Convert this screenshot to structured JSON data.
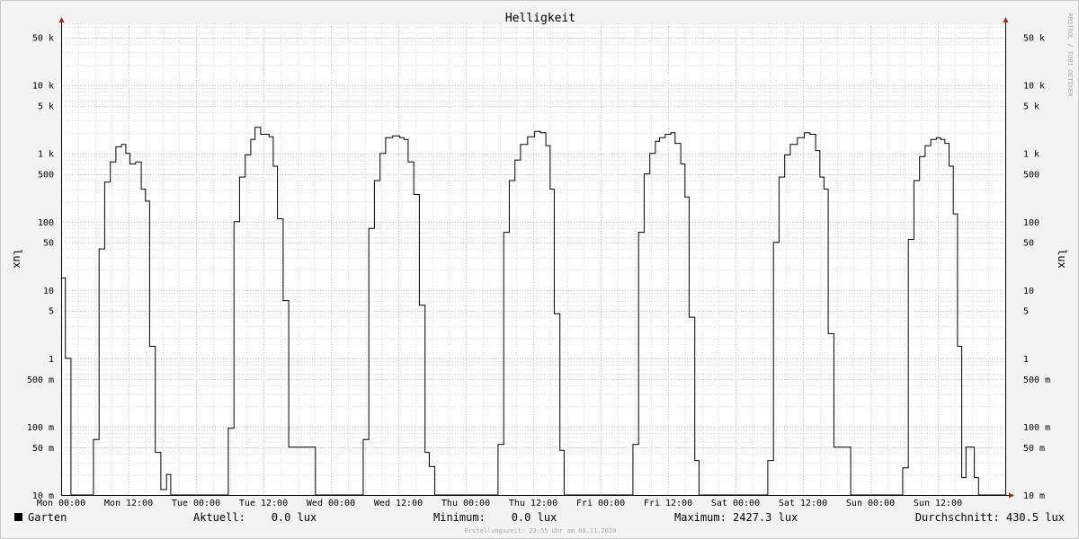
{
  "chart_data": {
    "type": "line",
    "title": "Helligkeit",
    "ylabel": "lux",
    "y_scale": "log",
    "ylim_lux": [
      0.01,
      80000
    ],
    "y_ticks": [
      {
        "value": 50000,
        "label": "50 k"
      },
      {
        "value": 10000,
        "label": "10 k"
      },
      {
        "value": 5000,
        "label": "5 k"
      },
      {
        "value": 1000,
        "label": "1 k"
      },
      {
        "value": 500,
        "label": "500"
      },
      {
        "value": 100,
        "label": "100"
      },
      {
        "value": 50,
        "label": "50"
      },
      {
        "value": 10,
        "label": "10"
      },
      {
        "value": 5,
        "label": "5"
      },
      {
        "value": 1,
        "label": "1"
      },
      {
        "value": 0.5,
        "label": "500 m"
      },
      {
        "value": 0.1,
        "label": "100 m"
      },
      {
        "value": 0.05,
        "label": "50 m"
      },
      {
        "value": 0.01,
        "label": "10 m"
      }
    ],
    "x_unit": "hours since Mon 00:00",
    "xlim_hours": [
      0,
      168
    ],
    "x_ticks": [
      {
        "value": 0,
        "label": "Mon 00:00"
      },
      {
        "value": 12,
        "label": "Mon 12:00"
      },
      {
        "value": 24,
        "label": "Tue 00:00"
      },
      {
        "value": 36,
        "label": "Tue 12:00"
      },
      {
        "value": 48,
        "label": "Wed 00:00"
      },
      {
        "value": 60,
        "label": "Wed 12:00"
      },
      {
        "value": 72,
        "label": "Thu 00:00"
      },
      {
        "value": 84,
        "label": "Thu 12:00"
      },
      {
        "value": 96,
        "label": "Fri 00:00"
      },
      {
        "value": 108,
        "label": "Fri 12:00"
      },
      {
        "value": 120,
        "label": "Sat 00:00"
      },
      {
        "value": 132,
        "label": "Sat 12:00"
      },
      {
        "value": 144,
        "label": "Sun 00:00"
      },
      {
        "value": 156,
        "label": "Sun 12:00"
      }
    ],
    "grid": true,
    "series": [
      {
        "name": "Garten",
        "color": "#000000",
        "step": true,
        "points": [
          [
            0.0,
            15
          ],
          [
            0.75,
            1.0
          ],
          [
            1.75,
            0.01
          ],
          [
            5.75,
            0.065
          ],
          [
            6.75,
            40
          ],
          [
            7.75,
            380
          ],
          [
            8.75,
            750
          ],
          [
            9.75,
            1250
          ],
          [
            10.75,
            1350
          ],
          [
            11.5,
            1000
          ],
          [
            12.25,
            700
          ],
          [
            13.25,
            750
          ],
          [
            14.25,
            300
          ],
          [
            15.0,
            200
          ],
          [
            15.75,
            1.5
          ],
          [
            16.75,
            0.042
          ],
          [
            17.75,
            0.012
          ],
          [
            18.75,
            0.02
          ],
          [
            19.5,
            0.01
          ],
          [
            29.75,
            0.095
          ],
          [
            30.75,
            100
          ],
          [
            31.75,
            450
          ],
          [
            32.75,
            950
          ],
          [
            33.75,
            1600
          ],
          [
            34.5,
            2400
          ],
          [
            35.5,
            1900
          ],
          [
            37.0,
            1750
          ],
          [
            37.75,
            650
          ],
          [
            38.5,
            110
          ],
          [
            39.5,
            7
          ],
          [
            40.5,
            0.05
          ],
          [
            45.25,
            0.01
          ],
          [
            53.75,
            0.065
          ],
          [
            54.75,
            80
          ],
          [
            55.75,
            400
          ],
          [
            56.75,
            1000
          ],
          [
            57.75,
            1700
          ],
          [
            59.0,
            1800
          ],
          [
            60.25,
            1700
          ],
          [
            61.0,
            1600
          ],
          [
            61.75,
            750
          ],
          [
            62.75,
            250
          ],
          [
            63.75,
            6
          ],
          [
            64.75,
            0.042
          ],
          [
            65.5,
            0.026
          ],
          [
            66.5,
            0.01
          ],
          [
            77.75,
            0.055
          ],
          [
            78.75,
            70
          ],
          [
            79.75,
            400
          ],
          [
            80.75,
            800
          ],
          [
            81.75,
            1350
          ],
          [
            83.0,
            1750
          ],
          [
            84.25,
            2100
          ],
          [
            85.25,
            2000
          ],
          [
            86.25,
            1300
          ],
          [
            87.0,
            300
          ],
          [
            87.75,
            4.5
          ],
          [
            88.75,
            0.045
          ],
          [
            89.5,
            0.01
          ],
          [
            101.75,
            0.055
          ],
          [
            102.75,
            70
          ],
          [
            103.75,
            500
          ],
          [
            104.75,
            1000
          ],
          [
            105.75,
            1500
          ],
          [
            106.5,
            1700
          ],
          [
            107.5,
            1900
          ],
          [
            108.5,
            2000
          ],
          [
            109.25,
            1400
          ],
          [
            110.25,
            700
          ],
          [
            111.0,
            230
          ],
          [
            111.75,
            4
          ],
          [
            112.75,
            0.032
          ],
          [
            113.5,
            0.01
          ],
          [
            125.75,
            0.032
          ],
          [
            126.75,
            50
          ],
          [
            127.75,
            450
          ],
          [
            128.75,
            950
          ],
          [
            129.75,
            1350
          ],
          [
            131.0,
            1700
          ],
          [
            132.25,
            2000
          ],
          [
            133.25,
            1900
          ],
          [
            134.25,
            1100
          ],
          [
            135.0,
            450
          ],
          [
            135.75,
            300
          ],
          [
            136.5,
            2.3
          ],
          [
            137.5,
            0.05
          ],
          [
            140.5,
            0.01
          ],
          [
            149.75,
            0.025
          ],
          [
            150.75,
            55
          ],
          [
            151.75,
            400
          ],
          [
            152.75,
            900
          ],
          [
            153.75,
            1300
          ],
          [
            154.75,
            1600
          ],
          [
            155.75,
            1700
          ],
          [
            156.5,
            1600
          ],
          [
            157.25,
            1400
          ],
          [
            158.0,
            650
          ],
          [
            158.75,
            130
          ],
          [
            159.5,
            1.5
          ],
          [
            160.25,
            0.018
          ],
          [
            161.0,
            0.05
          ],
          [
            162.5,
            0.018
          ],
          [
            163.25,
            0.01
          ]
        ]
      }
    ]
  },
  "watermark": "RRDTOOL / TOBI OETIKER",
  "legend": {
    "series_name": "Garten",
    "swatch_color": "#000000",
    "current": "Aktuell:    0.0 lux",
    "minimum": "Minimum:    0.0 lux",
    "maximum": "Maximum: 2427.3 lux",
    "average": "Durchschnitt: 430.5 lux"
  },
  "footer": "Erstellungszeit: 23:55 Uhr am 08.11.2020"
}
